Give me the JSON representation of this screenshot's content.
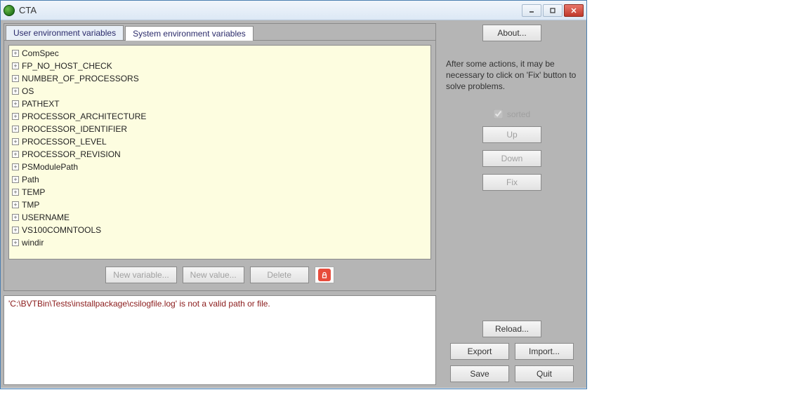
{
  "window": {
    "title": "CTA"
  },
  "tabs": {
    "user": "User environment variables",
    "system": "System environment variables",
    "active": "system"
  },
  "variables": [
    "ComSpec",
    "FP_NO_HOST_CHECK",
    "NUMBER_OF_PROCESSORS",
    "OS",
    "PATHEXT",
    "PROCESSOR_ARCHITECTURE",
    "PROCESSOR_IDENTIFIER",
    "PROCESSOR_LEVEL",
    "PROCESSOR_REVISION",
    "PSModulePath",
    "Path",
    "TEMP",
    "TMP",
    "USERNAME",
    "VS100COMNTOOLS",
    "windir"
  ],
  "toolbar": {
    "new_variable": "New variable...",
    "new_value": "New value...",
    "delete": "Delete"
  },
  "log": {
    "message": "'C:\\BVTBin\\Tests\\installpackage\\csilogfile.log' is not a valid path or file."
  },
  "right": {
    "about": "About...",
    "info": "After some actions, it may be necessary to click on 'Fix' button to solve problems.",
    "sorted_label": "sorted",
    "sorted_checked": true,
    "up": "Up",
    "down": "Down",
    "fix": "Fix",
    "reload": "Reload...",
    "export": "Export",
    "import": "Import...",
    "save": "Save",
    "quit": "Quit"
  }
}
